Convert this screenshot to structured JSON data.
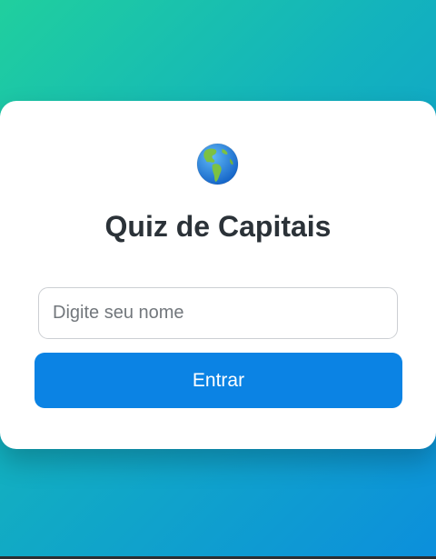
{
  "card": {
    "icon": "globe-americas-icon",
    "title": "Quiz de Capitais",
    "name_input": {
      "placeholder": "Digite seu nome",
      "value": ""
    },
    "enter_button_label": "Entrar"
  },
  "colors": {
    "background_gradient_start": "#20cf9e",
    "background_gradient_end": "#0c8fdc",
    "card_background": "#ffffff",
    "title_text": "#2b3238",
    "button_background": "#0b83e4",
    "button_text": "#ffffff"
  }
}
